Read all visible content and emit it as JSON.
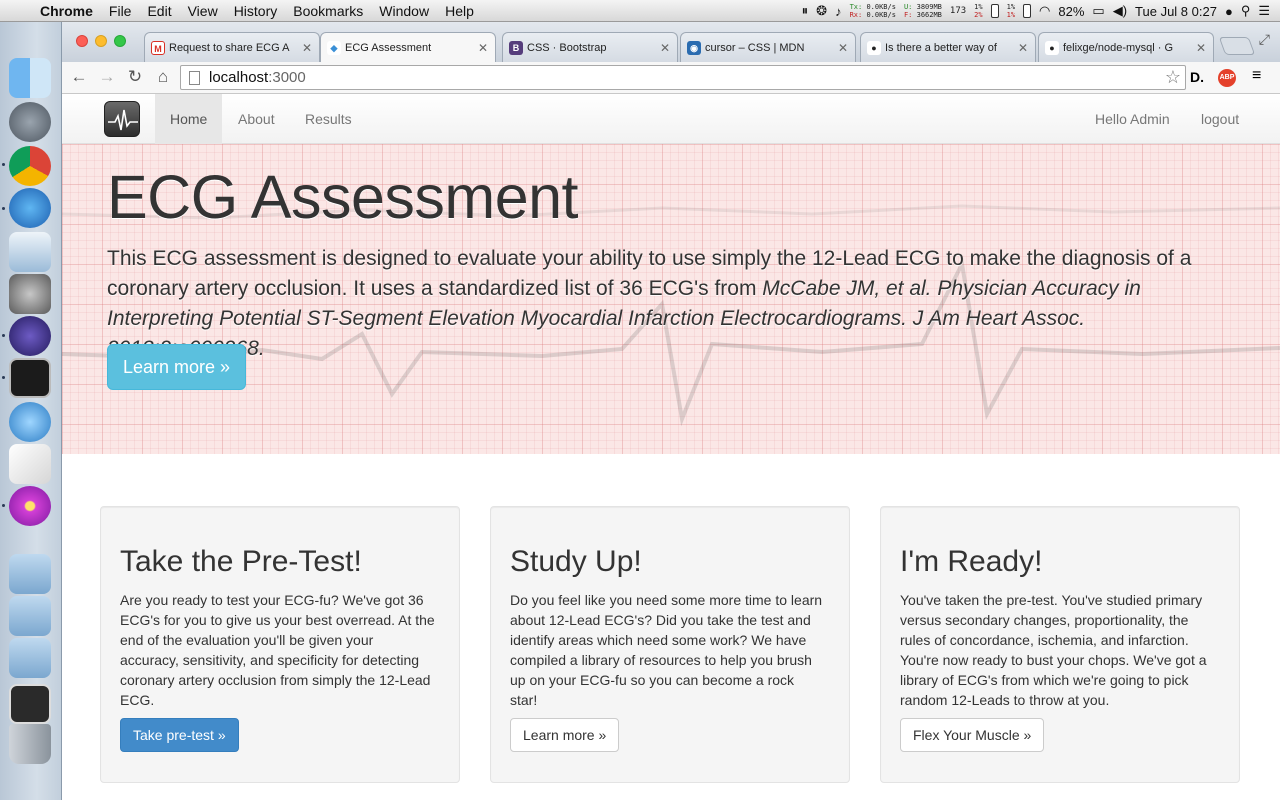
{
  "menubar": {
    "app": "Chrome",
    "items": [
      "File",
      "Edit",
      "View",
      "History",
      "Bookmarks",
      "Window",
      "Help"
    ],
    "net_tx_label": "Tx:",
    "net_tx_value": "0.0KB/s",
    "net_rx_label": "Rx:",
    "net_rx_value": "0.0KB/s",
    "mem_used_label": "U:",
    "mem_used_value": "3809MB",
    "mem_free_label": "F:",
    "mem_free_value": "3662MB",
    "proc_count": "173",
    "cpu_a_top": "1%",
    "cpu_a_bottom": "2%",
    "cpu_b_top": "1%",
    "cpu_b_bottom": "1%",
    "battery": "82%",
    "clock": "Tue Jul 8  0:27"
  },
  "browser": {
    "tabs": [
      {
        "title": "Request to share ECG A",
        "favicon": "gmail-icon",
        "color": "#d93025",
        "glyph": "M"
      },
      {
        "title": "ECG Assessment",
        "favicon": "page-icon",
        "color": "#3a8fd6",
        "glyph": "◆"
      },
      {
        "title": "CSS · Bootstrap",
        "favicon": "bootstrap-icon",
        "color": "#563d7c",
        "glyph": "B"
      },
      {
        "title": "cursor – CSS | MDN",
        "favicon": "mdn-icon",
        "color": "#2b6cb0",
        "glyph": "◉"
      },
      {
        "title": "Is there a better way of",
        "favicon": "github-icon",
        "color": "#222222",
        "glyph": "●"
      },
      {
        "title": "felixge/node-mysql · G",
        "favicon": "github-icon",
        "color": "#222222",
        "glyph": "●"
      }
    ],
    "url_host": "localhost",
    "url_port": ":3000",
    "ext_d": "D.",
    "ext_abp": "ABP"
  },
  "navbar": {
    "links": [
      "Home",
      "About",
      "Results"
    ],
    "user_greeting": "Hello Admin",
    "logout": "logout"
  },
  "jumbotron": {
    "title": "ECG Assessment",
    "lead_plain": "This ECG assessment is designed to evaluate your ability to use simply the 12-Lead ECG to make the diagnosis of a coronary artery occlusion. It uses a standardized list of 36 ECG's from ",
    "lead_citation": "McCabe JM, et al. Physician Accuracy in Interpreting Potential ST-Segment Elevation Myocardial Infarction Electrocardiograms. J Am Heart Assoc. 2013;2:e000268.",
    "button": "Learn more »"
  },
  "cards": [
    {
      "title": "Take the Pre-Test!",
      "body": "Are you ready to test your ECG-fu? We've got 36 ECG's for you to give us your best overread. At the end of the evaluation you'll be given your accuracy, sensitivity, and specificity for detecting coronary artery occlusion from simply the 12-Lead ECG.",
      "button": "Take pre-test »"
    },
    {
      "title": "Study Up!",
      "body": "Do you feel like you need some more time to learn about 12-Lead ECG's? Did you take the test and identify areas which need some work? We have compiled a library of resources to help you brush up on your ECG-fu so you can become a rock star!",
      "button": "Learn more »"
    },
    {
      "title": "I'm Ready!",
      "body": "You've taken the pre-test. You've studied primary versus secondary changes, proportionality, the rules of concordance, ischemia, and infarction. You're now ready to bust your chops. We've got a library of ECG's from which we're going to pick random 12-Leads to throw at you.",
      "button": "Flex Your Muscle »"
    }
  ]
}
